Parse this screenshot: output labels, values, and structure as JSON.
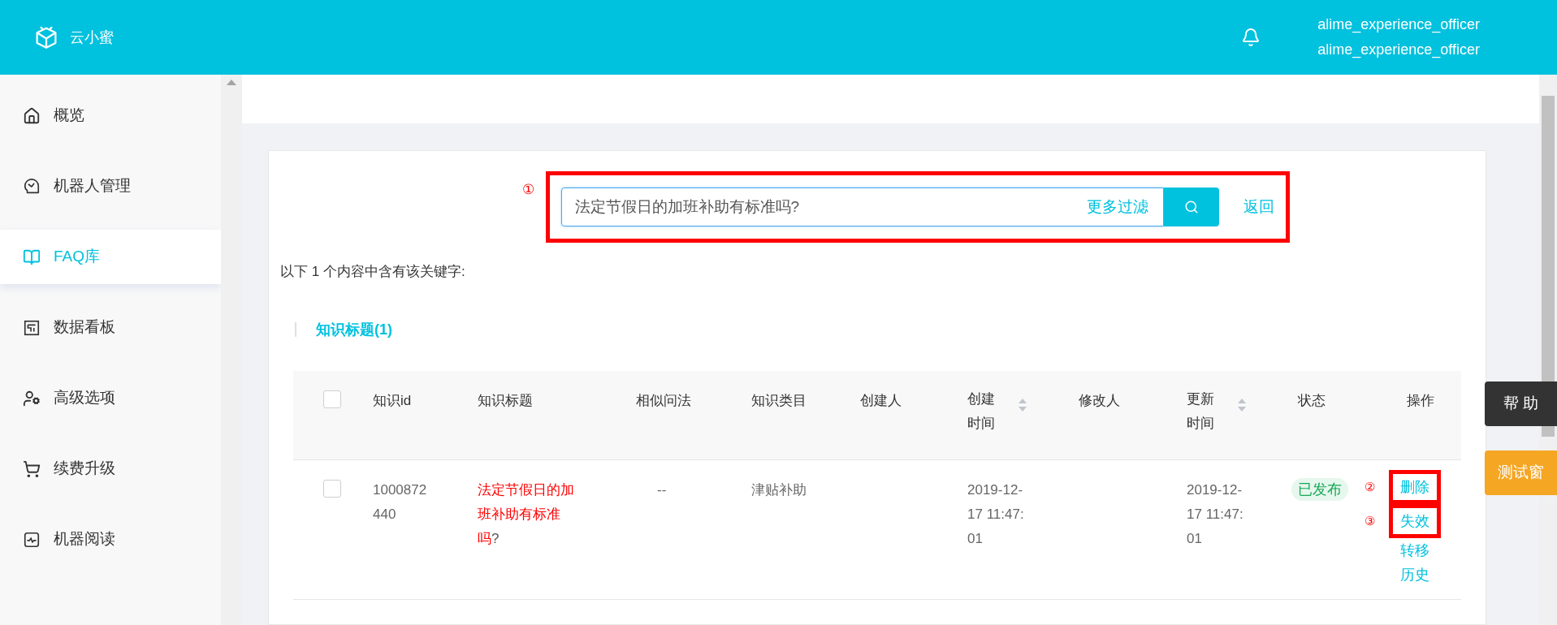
{
  "header": {
    "brand": "云小蜜",
    "user_lines": [
      "alime_experience_officer",
      "alime_experience_officer"
    ]
  },
  "sidebar": {
    "items": [
      {
        "label": "概览",
        "selected": false
      },
      {
        "label": "机器人管理",
        "selected": false
      },
      {
        "label": "FAQ库",
        "selected": true
      },
      {
        "label": "数据看板",
        "selected": false
      },
      {
        "label": "高级选项",
        "selected": false
      },
      {
        "label": "续费升级",
        "selected": false
      },
      {
        "label": "机器阅读",
        "selected": false
      }
    ]
  },
  "search": {
    "annotation": "①",
    "value": "法定节假日的加班补助有标准吗?",
    "filter_link": "更多过滤",
    "back_link": "返回"
  },
  "result_summary": "以下 1 个内容中含有该关键字:",
  "section_tab": {
    "label": "知识标题(1)",
    "selected": true
  },
  "table": {
    "checked": false,
    "columns": [
      {
        "label": "知识id",
        "sortable": false
      },
      {
        "label": "知识标题",
        "sortable": false
      },
      {
        "label": "相似问法",
        "sortable": false
      },
      {
        "label": "知识类目",
        "sortable": false
      },
      {
        "label": "创建人",
        "sortable": false
      },
      {
        "label": "创建时间",
        "sortable": true
      },
      {
        "label": "修改人",
        "sortable": false
      },
      {
        "label": "更新时间",
        "sortable": true
      },
      {
        "label": "状态",
        "sortable": false
      },
      {
        "label": "操作",
        "sortable": false
      }
    ],
    "rows": [
      {
        "checked": false,
        "id": "1000872440",
        "title_match": "法定节假日的加班补助有标准吗",
        "title_rest": "?",
        "similar": "--",
        "category": "津贴补助",
        "created": "2019-12-17 11:47:01",
        "updated": "2019-12-17 11:47:01",
        "status": "已发布",
        "actions": [
          {
            "label": "删除",
            "annotation": "②"
          },
          {
            "label": "失效",
            "annotation": "③"
          },
          {
            "label": "转移"
          },
          {
            "label": "历史"
          }
        ]
      }
    ]
  },
  "float_buttons": [
    {
      "label": "帮 助",
      "kind": "dark"
    },
    {
      "label": "测试窗",
      "kind": "accent"
    }
  ]
}
